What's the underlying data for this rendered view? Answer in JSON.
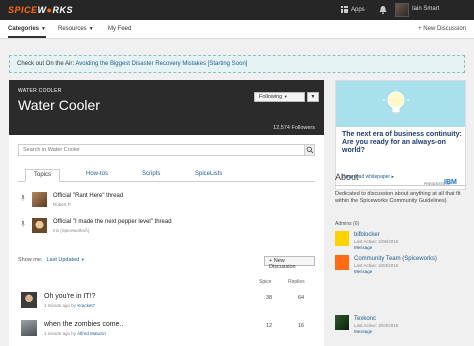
{
  "header": {
    "logo_part1": "SPICE",
    "logo_part2": "W",
    "logo_part3": "RKS",
    "apps_label": "Apps",
    "user_name": "Iain Smart"
  },
  "subnav": {
    "categories": "Categories",
    "resources": "Resources",
    "my_feed": "My Feed",
    "new_discussion": "+ New Discussion"
  },
  "banner": {
    "prefix": "Check out On the Air: ",
    "link": "Avoiding the Biggest Disaster Recovery Mistakes [Starting Soon]"
  },
  "group": {
    "crumb": "WATER COOLER",
    "title": "Water Cooler",
    "follow_label": "Following",
    "followers": "12,574 Followers"
  },
  "search": {
    "placeholder": "Search in Water Cooler"
  },
  "tabs": [
    "Topics",
    "How-tos",
    "Scripts",
    "SpiceLists"
  ],
  "pinned": [
    {
      "title": "Official \"Rant Here\" thread",
      "user": "Robert.P"
    },
    {
      "title": "Official \"I made the next pepper level\" thread",
      "user": "Iris (SpiceworksÂ)"
    }
  ],
  "filter": {
    "show_me": "Show me:",
    "selected": "Last Updated",
    "new_discussion": "+ New Discussion"
  },
  "columns": {
    "spice": "Spice",
    "replies": "Replies"
  },
  "topics": [
    {
      "title": "Oh you're in IT!?",
      "time": "1 minute ago",
      "by": "by",
      "user": "Kracket7",
      "spice": "38",
      "replies": "64"
    },
    {
      "title": "when the zombies come..",
      "time": "1 minute ago",
      "by": "by",
      "user": "Alfred Matuzin",
      "spice": "12",
      "replies": "16"
    }
  ],
  "ad": {
    "headline": "The next era of business continuity: Are you ready for an always-on world?",
    "download": "Download whitepaper ▸",
    "presented_by": "PRESENTED BY",
    "brand": "IBM"
  },
  "about": {
    "heading": "About",
    "text": "Dedicated to discussion about anything at all that fit within the Spiceworks Community Guidelines)",
    "admins_label": "Admins (6)",
    "admins": [
      {
        "name": "bifblocker",
        "last": "Last Active: 2/06/2015",
        "msg": "Message"
      },
      {
        "name": "Community Team (Spiceworks)",
        "last": "Last Active: 3/03/2015",
        "msg": "Message"
      },
      {
        "name": "Texkonc",
        "last": "Last Active: 3/03/2015",
        "msg": "Message"
      }
    ]
  },
  "colors": {
    "topbar": "#262626",
    "brand_orange": "#ff6a13",
    "link_blue": "#1e5d8c",
    "hero_dark": "#2b2b2b",
    "banner_bg": "#e6f3f5"
  }
}
